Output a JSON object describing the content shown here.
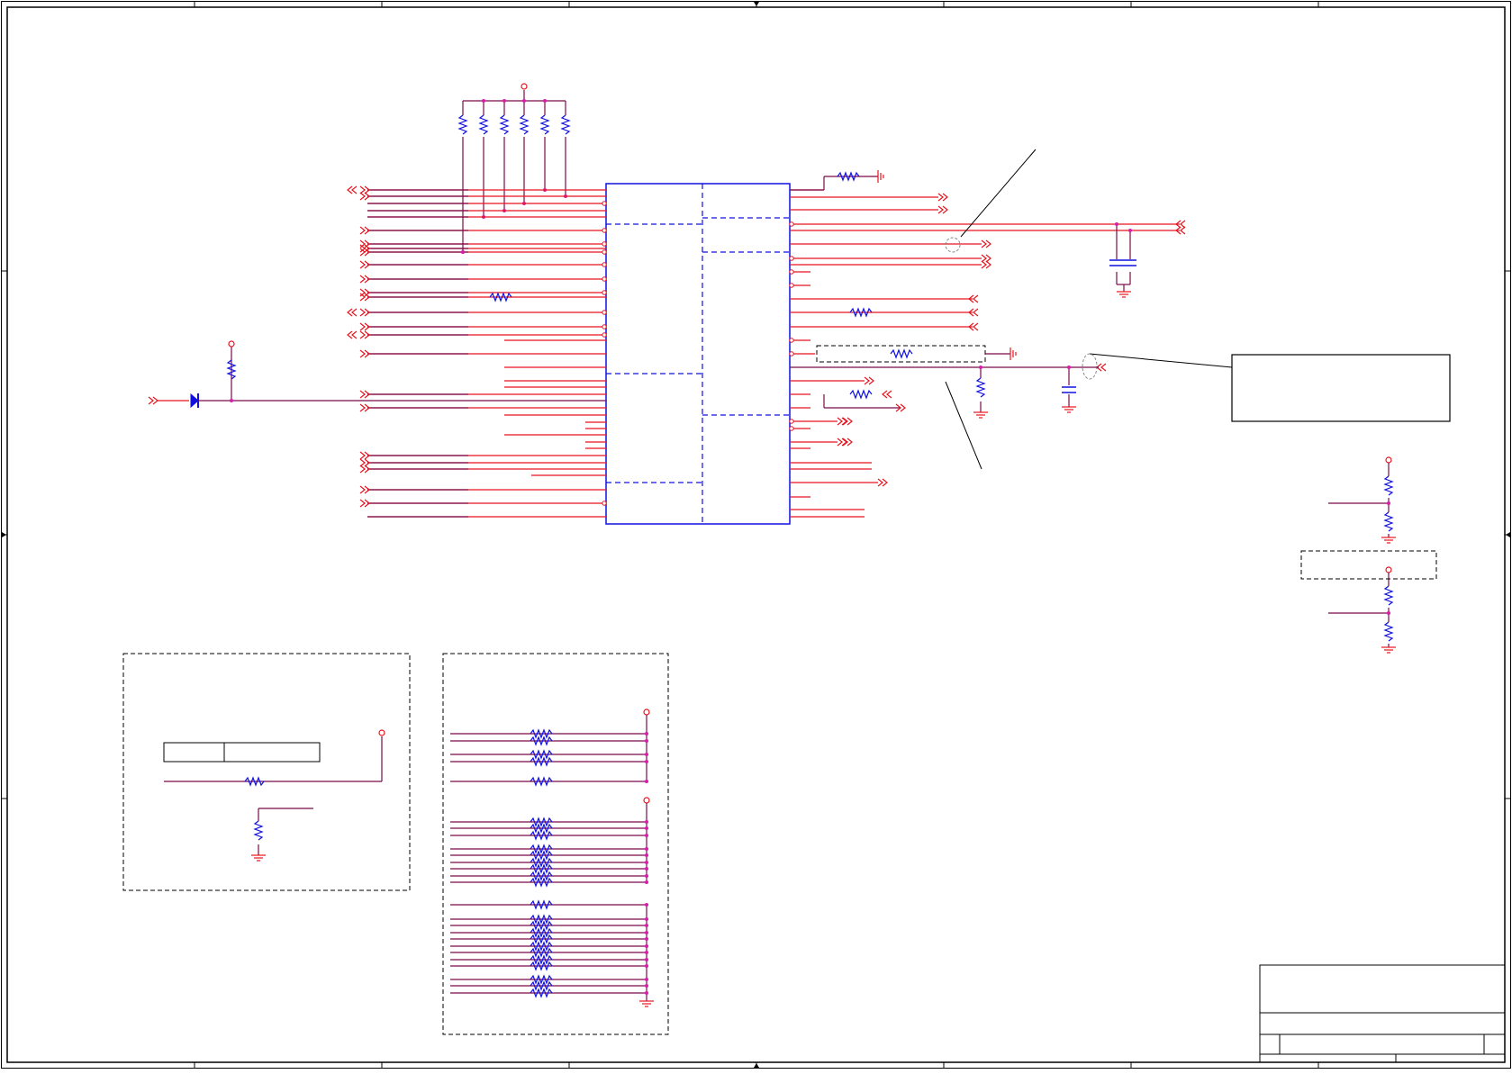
{
  "colors": {
    "wire": "#e8141e",
    "net": "#7a0a4a",
    "component": "#1010e0",
    "junction": "#d81ea8",
    "border": "#000000",
    "dashed": "#000000"
  },
  "icons": [
    "resistor-icon",
    "capacitor-icon",
    "diode-icon",
    "ground-icon",
    "power-flag-icon",
    "off-page-connector-icon"
  ]
}
